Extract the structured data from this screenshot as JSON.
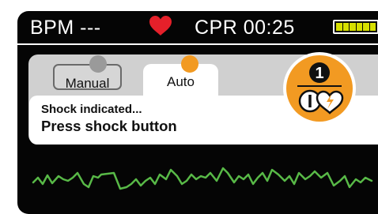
{
  "status": {
    "bpm_text": "BPM ---",
    "cpr_text": "CPR 00:25",
    "battery_cells": 6,
    "heart_color": "#e5202a",
    "battery_color": "#d7e000"
  },
  "mode": {
    "manual_label": "Manual",
    "auto_label": "Auto",
    "selected": "Auto",
    "accent_color": "#f29a22"
  },
  "message": {
    "line1": "Shock indicated...",
    "line2": "Press shock button"
  },
  "shock_badge": {
    "count": "1",
    "icons": [
      "power-icon",
      "heart-lightning-icon"
    ]
  },
  "waveform": {
    "color": "#58b947",
    "label": "ecg-trace"
  }
}
